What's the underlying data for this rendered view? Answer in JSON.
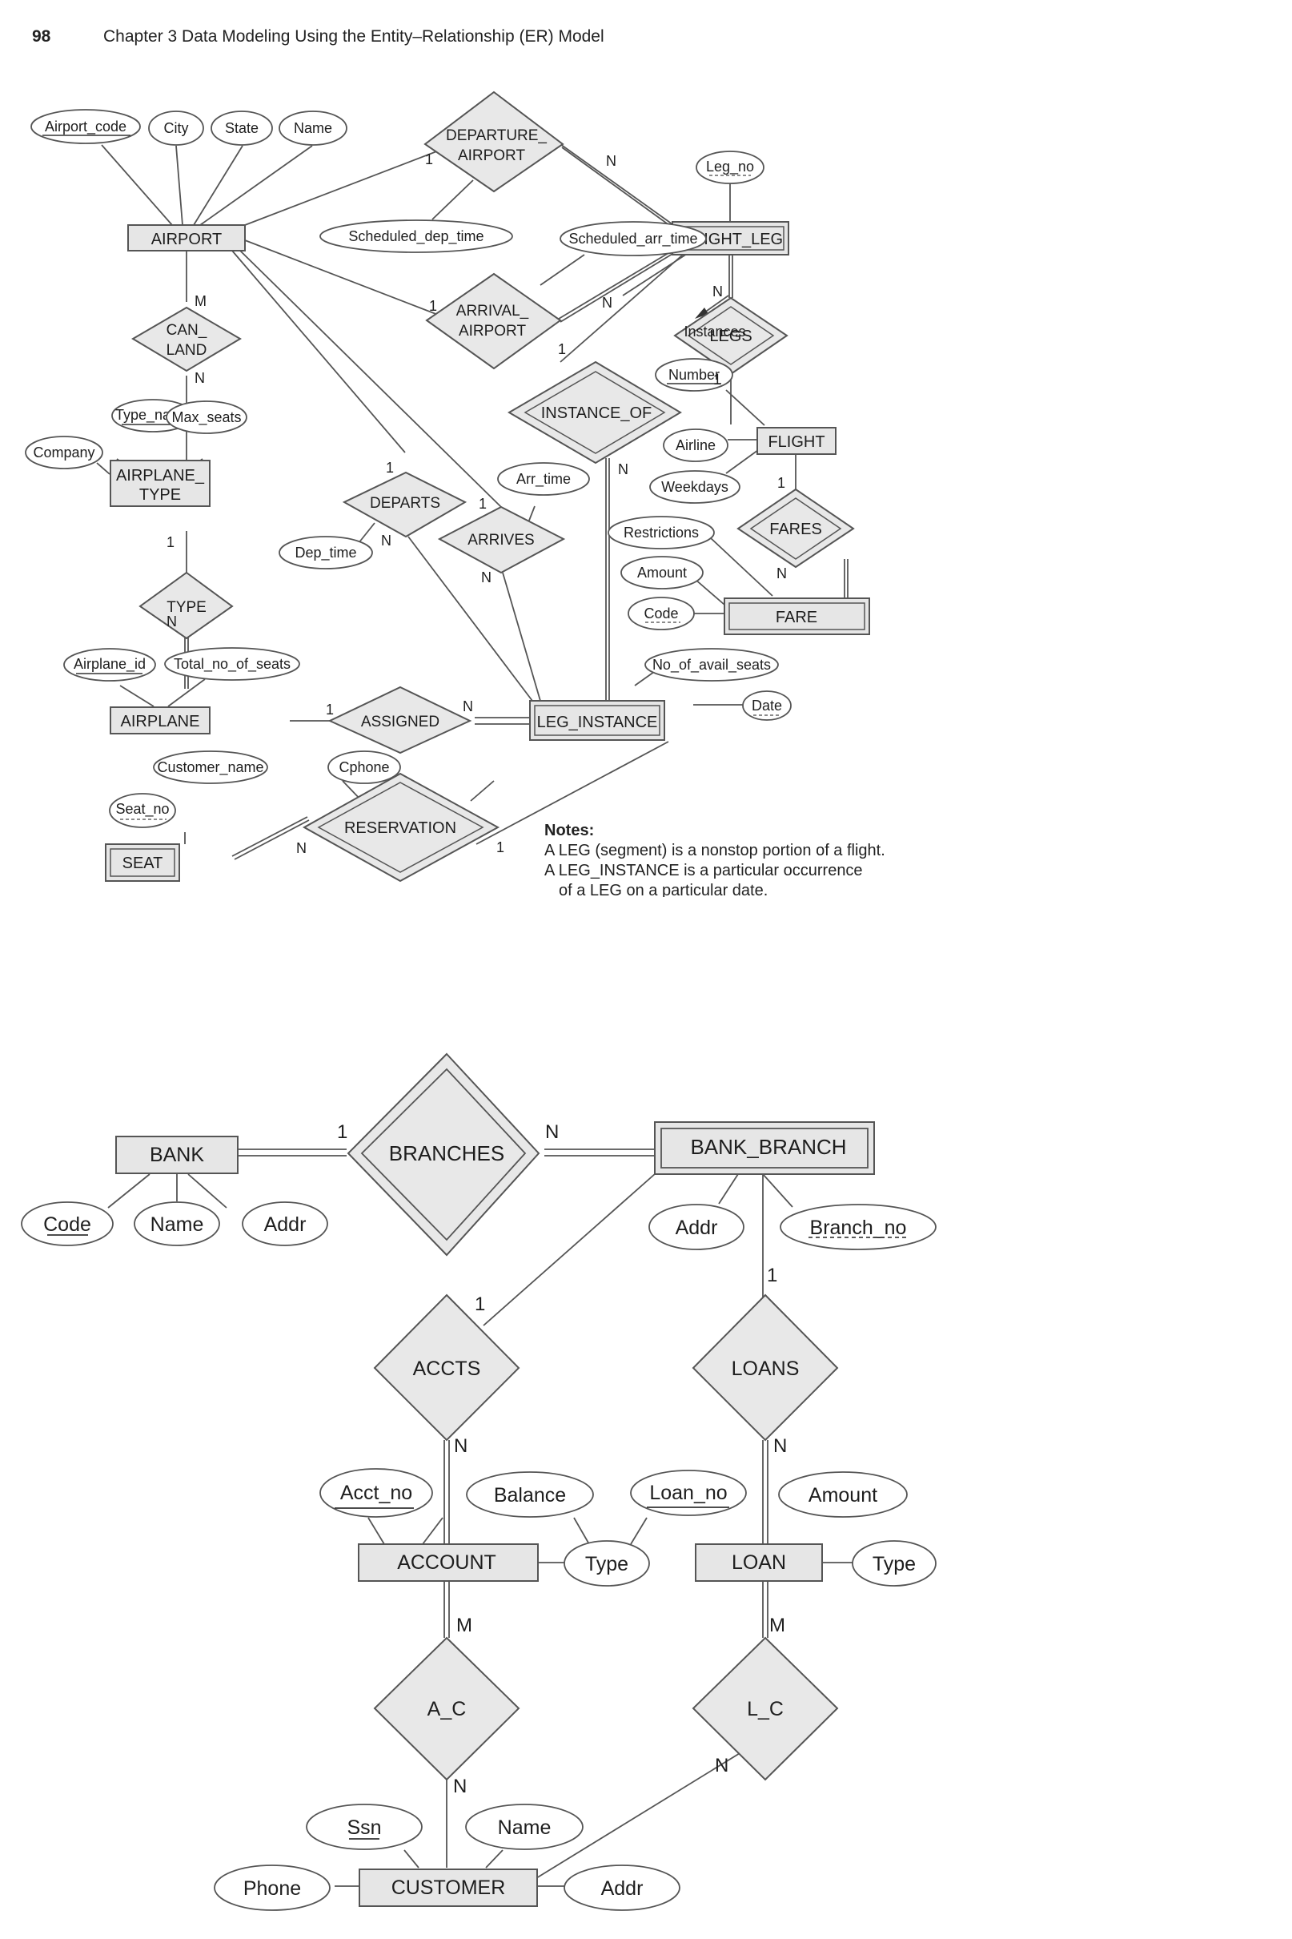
{
  "header": {
    "page_number": "98",
    "chapter_title": "Chapter 3  Data Modeling Using the Entity–Relationship (ER) Model"
  },
  "airline_diagram": {
    "entities": {
      "airport": "AIRPORT",
      "flight_leg": "FLIGHT_LEG",
      "flight": "FLIGHT",
      "fare": "FARE",
      "airplane_type_1": "AIRPLANE_",
      "airplane_type_2": "TYPE",
      "airplane": "AIRPLANE",
      "leg_instance": "LEG_INSTANCE",
      "seat": "SEAT"
    },
    "relationships": {
      "departure_airport_1": "DEPARTURE_",
      "departure_airport_2": "AIRPORT",
      "arrival_airport_1": "ARRIVAL_",
      "arrival_airport_2": "AIRPORT",
      "can_land_1": "CAN_",
      "can_land_2": "LAND",
      "legs": "LEGS",
      "instance_of": "INSTANCE_OF",
      "departs": "DEPARTS",
      "arrives": "ARRIVES",
      "fares": "FARES",
      "type": "TYPE",
      "assigned": "ASSIGNED",
      "reservation": "RESERVATION"
    },
    "attributes": {
      "airport_code": "Airport_code",
      "city": "City",
      "state": "State",
      "name": "Name",
      "scheduled_dep_time": "Scheduled_dep_time",
      "scheduled_arr_time": "Scheduled_arr_time",
      "leg_no": "Leg_no",
      "number": "Number",
      "airline": "Airline",
      "weekdays": "Weekdays",
      "type_name": "Type_name",
      "max_seats": "Max_seats",
      "company": "Company",
      "arr_time": "Arr_time",
      "dep_time": "Dep_time",
      "restrictions": "Restrictions",
      "amount": "Amount",
      "code": "Code",
      "airplane_id": "Airplane_id",
      "total_no_of_seats": "Total_no_of_seats",
      "no_of_avail_seats": "No_of_avail_seats",
      "date": "Date",
      "customer_name": "Customer_name",
      "cphone": "Cphone",
      "seat_no": "Seat_no"
    },
    "annotations": {
      "instances": "Instances"
    },
    "cardinalities": {
      "dep_airport_side": "1",
      "dep_flightleg_side": "N",
      "arr_airport_side": "1",
      "arr_flightleg_side": "N",
      "canland_airport": "M",
      "canland_type": "N",
      "legs_flightleg": "N",
      "legs_flight": "1",
      "instanceof_flightleg": "1",
      "instanceof_leginstance": "N",
      "departs_airport": "1",
      "departs_leginstance": "N",
      "arrives_airport": "1",
      "arrives_leginstance": "N",
      "fares_flight": "1",
      "fares_fare": "N",
      "type_airplanetype": "1",
      "type_airplane": "N",
      "assigned_airplane": "1",
      "assigned_leginstance": "N",
      "reservation_seat": "N",
      "reservation_leginstance": "1"
    },
    "notes": {
      "title": "Notes:",
      "line1": "A LEG (segment) is a nonstop portion of a flight.",
      "line2": "A LEG_INSTANCE is a particular occurrence",
      "line3": "of a LEG on a particular date."
    }
  },
  "bank_diagram": {
    "entities": {
      "bank": "BANK",
      "bank_branch": "BANK_BRANCH",
      "account": "ACCOUNT",
      "loan": "LOAN",
      "customer": "CUSTOMER"
    },
    "relationships": {
      "branches": "BRANCHES",
      "accts": "ACCTS",
      "loans": "LOANS",
      "a_c": "A_C",
      "l_c": "L_C"
    },
    "attributes": {
      "bank_code": "Code",
      "bank_name": "Name",
      "bank_addr": "Addr",
      "branch_addr": "Addr",
      "branch_no": "Branch_no",
      "acct_no": "Acct_no",
      "balance": "Balance",
      "account_type": "Type",
      "loan_no": "Loan_no",
      "loan_amount": "Amount",
      "loan_type": "Type",
      "ssn": "Ssn",
      "customer_name": "Name",
      "phone": "Phone",
      "customer_addr": "Addr"
    },
    "cardinalities": {
      "branches_bank": "1",
      "branches_branch": "N",
      "accts_branch": "1",
      "accts_account": "N",
      "loans_branch": "1",
      "loans_loan": "N",
      "ac_account": "M",
      "ac_customer": "N",
      "lc_loan": "M",
      "lc_customer": "N"
    }
  }
}
